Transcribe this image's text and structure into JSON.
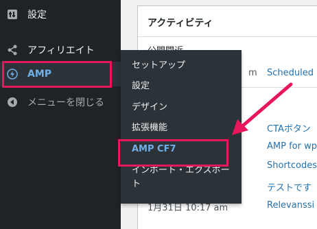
{
  "sidebar": {
    "settings_label": "設定",
    "affiliate_label": "アフィリエイト",
    "amp_label": "AMP",
    "collapse_label": "メニューを閉じる"
  },
  "flyout": {
    "items": [
      {
        "label": "セットアップ"
      },
      {
        "label": "設定"
      },
      {
        "label": "デザイン"
      },
      {
        "label": "拡張機能"
      },
      {
        "label": "AMP CF7"
      },
      {
        "label": "インポート・エクスポート"
      }
    ],
    "current_label": "AMP CF7"
  },
  "activity": {
    "title": "アクティビティ",
    "section": "公開間近",
    "scheduled_meta": "m",
    "scheduled_link": "Scheduled",
    "recent_date": "1月31日 10:17 am",
    "recent_links": [
      "CTAボタン",
      "AMP for wp",
      "Shortcodes",
      "テストです",
      "Relevanssi"
    ]
  },
  "colors": {
    "sidebar_bg": "#1d2327",
    "flyout_bg": "#2c3338",
    "accent": "#72aee6",
    "link": "#2271b1",
    "highlight": "#e8175d"
  },
  "icons": [
    "settings-icon",
    "share-icon",
    "amp-lightning-icon",
    "collapse-arrow-icon"
  ]
}
